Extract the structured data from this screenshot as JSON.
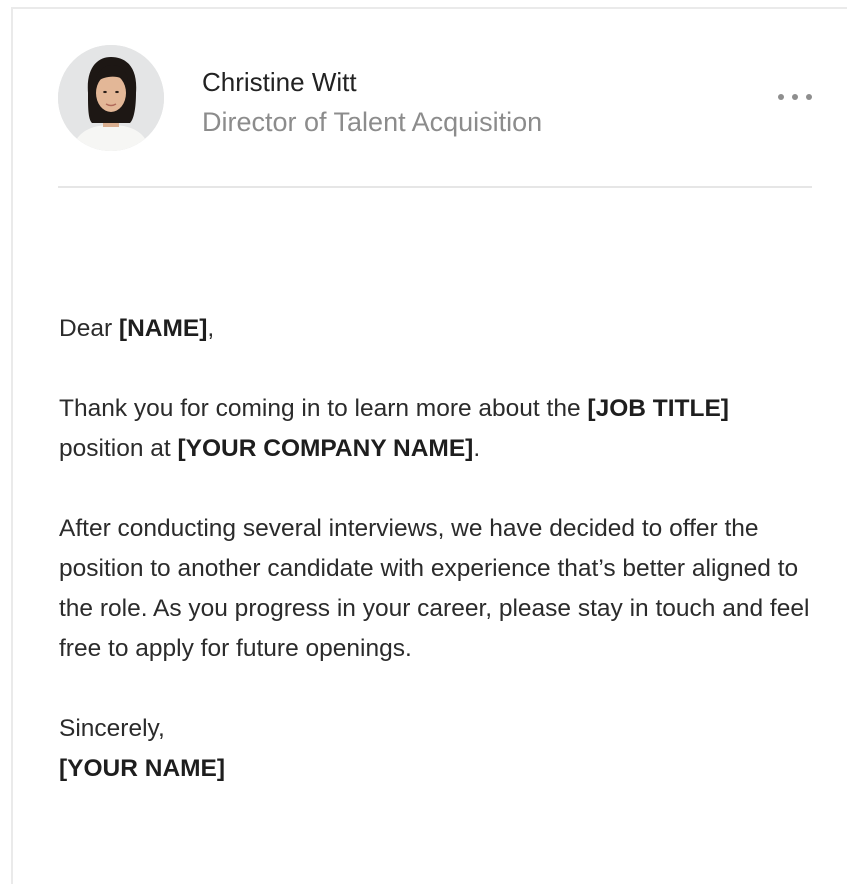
{
  "profile": {
    "name": "Christine Witt",
    "title": "Director of Talent Acquisition",
    "avatar_icon": "person-portrait-icon",
    "more_icon": "more-horizontal-icon"
  },
  "letter": {
    "greeting_prefix": "Dear ",
    "greeting_name": "[NAME]",
    "greeting_suffix": ",",
    "p1_text_a": "Thank you for coming in to learn more about the ",
    "p1_job_title": "[JOB TITLE]",
    "p1_text_b": " position at ",
    "p1_company": "[YOUR COMPANY NAME]",
    "p1_text_c": ".",
    "p2_text": "After conducting several interviews, we have decided to offer the position to another candidate with experience that’s better aligned to the role. As you progress in your career, please stay in touch and feel free to apply for future openings.",
    "signoff": "Sincerely,",
    "signature": "[YOUR NAME]"
  },
  "colors": {
    "name": "#222222",
    "subtitle": "#8c8c8c",
    "body_text": "#2b2b2b",
    "divider": "#e6e6e6"
  }
}
